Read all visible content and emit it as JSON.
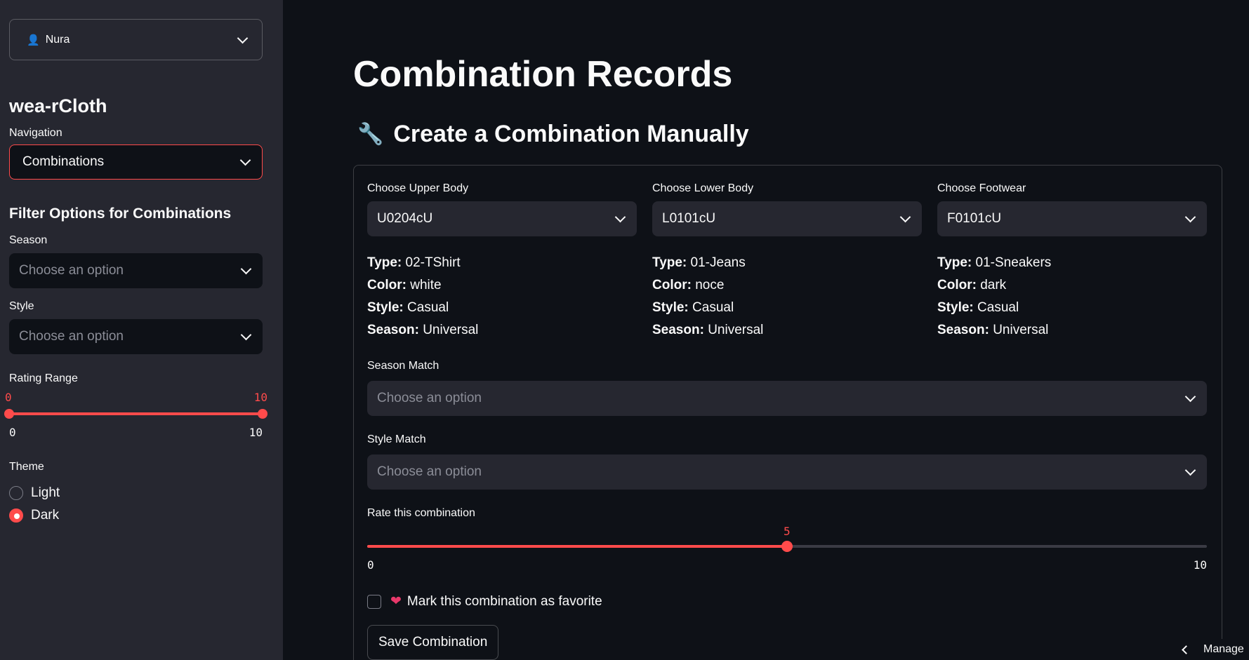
{
  "sidebar": {
    "user": "Nura",
    "app_title": "wea-rCloth",
    "navigation_label": "Navigation",
    "navigation_value": "Combinations",
    "filter_heading": "Filter Options for Combinations",
    "season_label": "Season",
    "season_placeholder": "Choose an option",
    "style_label": "Style",
    "style_placeholder": "Choose an option",
    "rating_label": "Rating Range",
    "rating_min_value": "0",
    "rating_max_value": "10",
    "rating_tick_min": "0",
    "rating_tick_max": "10",
    "theme_label": "Theme",
    "theme_options": [
      "Light",
      "Dark"
    ],
    "theme_selected": "Dark"
  },
  "main": {
    "title": "Combination Records",
    "section_title": "Create a Combination Manually",
    "columns": [
      {
        "label": "Choose Upper Body",
        "value": "U0204cU",
        "type": "02-TShirt",
        "color": "white",
        "style": "Casual",
        "season": "Universal"
      },
      {
        "label": "Choose Lower Body",
        "value": "L0101cU",
        "type": "01-Jeans",
        "color": "noce",
        "style": "Casual",
        "season": "Universal"
      },
      {
        "label": "Choose Footwear",
        "value": "F0101cU",
        "type": "01-Sneakers",
        "color": "dark",
        "style": "Casual",
        "season": "Universal"
      }
    ],
    "attr_labels": {
      "type": "Type:",
      "color": "Color:",
      "style": "Style:",
      "season": "Season:"
    },
    "season_match_label": "Season Match",
    "season_match_placeholder": "Choose an option",
    "style_match_label": "Style Match",
    "style_match_placeholder": "Choose an option",
    "rate_label": "Rate this combination",
    "rate_value": 5,
    "rate_value_text": "5",
    "rate_min": 0,
    "rate_max": 10,
    "rate_min_text": "0",
    "rate_max_text": "10",
    "favorite_label": "Mark this combination as favorite",
    "save_label": "Save Combination",
    "manage_label": "Manage"
  },
  "colors": {
    "accent": "#ff4b4b",
    "background": "#0e1117",
    "sidebar": "#262730"
  }
}
